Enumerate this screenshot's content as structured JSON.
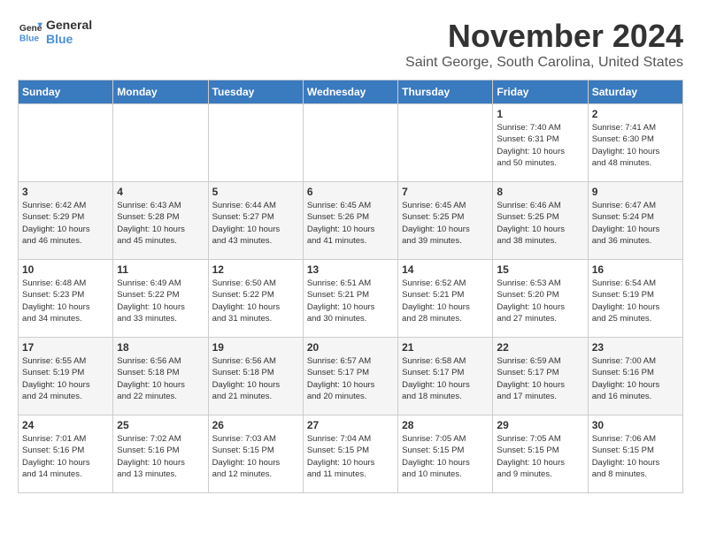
{
  "logo": {
    "general": "General",
    "blue": "Blue"
  },
  "title": "November 2024",
  "subtitle": "Saint George, South Carolina, United States",
  "weekdays": [
    "Sunday",
    "Monday",
    "Tuesday",
    "Wednesday",
    "Thursday",
    "Friday",
    "Saturday"
  ],
  "weeks": [
    [
      {
        "day": "",
        "info": ""
      },
      {
        "day": "",
        "info": ""
      },
      {
        "day": "",
        "info": ""
      },
      {
        "day": "",
        "info": ""
      },
      {
        "day": "",
        "info": ""
      },
      {
        "day": "1",
        "info": "Sunrise: 7:40 AM\nSunset: 6:31 PM\nDaylight: 10 hours\nand 50 minutes."
      },
      {
        "day": "2",
        "info": "Sunrise: 7:41 AM\nSunset: 6:30 PM\nDaylight: 10 hours\nand 48 minutes."
      }
    ],
    [
      {
        "day": "3",
        "info": "Sunrise: 6:42 AM\nSunset: 5:29 PM\nDaylight: 10 hours\nand 46 minutes."
      },
      {
        "day": "4",
        "info": "Sunrise: 6:43 AM\nSunset: 5:28 PM\nDaylight: 10 hours\nand 45 minutes."
      },
      {
        "day": "5",
        "info": "Sunrise: 6:44 AM\nSunset: 5:27 PM\nDaylight: 10 hours\nand 43 minutes."
      },
      {
        "day": "6",
        "info": "Sunrise: 6:45 AM\nSunset: 5:26 PM\nDaylight: 10 hours\nand 41 minutes."
      },
      {
        "day": "7",
        "info": "Sunrise: 6:45 AM\nSunset: 5:25 PM\nDaylight: 10 hours\nand 39 minutes."
      },
      {
        "day": "8",
        "info": "Sunrise: 6:46 AM\nSunset: 5:25 PM\nDaylight: 10 hours\nand 38 minutes."
      },
      {
        "day": "9",
        "info": "Sunrise: 6:47 AM\nSunset: 5:24 PM\nDaylight: 10 hours\nand 36 minutes."
      }
    ],
    [
      {
        "day": "10",
        "info": "Sunrise: 6:48 AM\nSunset: 5:23 PM\nDaylight: 10 hours\nand 34 minutes."
      },
      {
        "day": "11",
        "info": "Sunrise: 6:49 AM\nSunset: 5:22 PM\nDaylight: 10 hours\nand 33 minutes."
      },
      {
        "day": "12",
        "info": "Sunrise: 6:50 AM\nSunset: 5:22 PM\nDaylight: 10 hours\nand 31 minutes."
      },
      {
        "day": "13",
        "info": "Sunrise: 6:51 AM\nSunset: 5:21 PM\nDaylight: 10 hours\nand 30 minutes."
      },
      {
        "day": "14",
        "info": "Sunrise: 6:52 AM\nSunset: 5:21 PM\nDaylight: 10 hours\nand 28 minutes."
      },
      {
        "day": "15",
        "info": "Sunrise: 6:53 AM\nSunset: 5:20 PM\nDaylight: 10 hours\nand 27 minutes."
      },
      {
        "day": "16",
        "info": "Sunrise: 6:54 AM\nSunset: 5:19 PM\nDaylight: 10 hours\nand 25 minutes."
      }
    ],
    [
      {
        "day": "17",
        "info": "Sunrise: 6:55 AM\nSunset: 5:19 PM\nDaylight: 10 hours\nand 24 minutes."
      },
      {
        "day": "18",
        "info": "Sunrise: 6:56 AM\nSunset: 5:18 PM\nDaylight: 10 hours\nand 22 minutes."
      },
      {
        "day": "19",
        "info": "Sunrise: 6:56 AM\nSunset: 5:18 PM\nDaylight: 10 hours\nand 21 minutes."
      },
      {
        "day": "20",
        "info": "Sunrise: 6:57 AM\nSunset: 5:17 PM\nDaylight: 10 hours\nand 20 minutes."
      },
      {
        "day": "21",
        "info": "Sunrise: 6:58 AM\nSunset: 5:17 PM\nDaylight: 10 hours\nand 18 minutes."
      },
      {
        "day": "22",
        "info": "Sunrise: 6:59 AM\nSunset: 5:17 PM\nDaylight: 10 hours\nand 17 minutes."
      },
      {
        "day": "23",
        "info": "Sunrise: 7:00 AM\nSunset: 5:16 PM\nDaylight: 10 hours\nand 16 minutes."
      }
    ],
    [
      {
        "day": "24",
        "info": "Sunrise: 7:01 AM\nSunset: 5:16 PM\nDaylight: 10 hours\nand 14 minutes."
      },
      {
        "day": "25",
        "info": "Sunrise: 7:02 AM\nSunset: 5:16 PM\nDaylight: 10 hours\nand 13 minutes."
      },
      {
        "day": "26",
        "info": "Sunrise: 7:03 AM\nSunset: 5:15 PM\nDaylight: 10 hours\nand 12 minutes."
      },
      {
        "day": "27",
        "info": "Sunrise: 7:04 AM\nSunset: 5:15 PM\nDaylight: 10 hours\nand 11 minutes."
      },
      {
        "day": "28",
        "info": "Sunrise: 7:05 AM\nSunset: 5:15 PM\nDaylight: 10 hours\nand 10 minutes."
      },
      {
        "day": "29",
        "info": "Sunrise: 7:05 AM\nSunset: 5:15 PM\nDaylight: 10 hours\nand 9 minutes."
      },
      {
        "day": "30",
        "info": "Sunrise: 7:06 AM\nSunset: 5:15 PM\nDaylight: 10 hours\nand 8 minutes."
      }
    ]
  ]
}
